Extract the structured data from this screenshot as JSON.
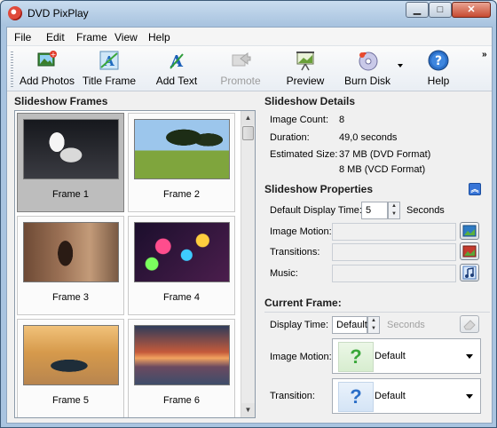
{
  "window": {
    "title": "DVD PixPlay",
    "minimize": "▁",
    "maximize": "□",
    "close": "✕"
  },
  "menu": [
    "File",
    "Edit",
    "Frame",
    "View",
    "Help"
  ],
  "toolbar": {
    "items": [
      {
        "label": "Add Photos",
        "icon": "add-photos-icon",
        "enabled": true
      },
      {
        "label": "Title Frame",
        "icon": "title-frame-icon",
        "enabled": true
      },
      {
        "label": "Add Text",
        "icon": "add-text-icon",
        "enabled": true
      },
      {
        "label": "Promote",
        "icon": "promote-icon",
        "enabled": false
      },
      {
        "label": "Preview",
        "icon": "preview-icon",
        "enabled": true
      },
      {
        "label": "Burn Disk",
        "icon": "burn-disk-icon",
        "enabled": true
      },
      {
        "label": "Help",
        "icon": "help-icon",
        "enabled": true
      }
    ],
    "overflow": "»"
  },
  "frames_panel": {
    "title": "Slideshow Frames",
    "frames": [
      {
        "label": "Frame 1",
        "selected": true
      },
      {
        "label": "Frame 2",
        "selected": false
      },
      {
        "label": "Frame 3",
        "selected": false
      },
      {
        "label": "Frame 4",
        "selected": false
      },
      {
        "label": "Frame 5",
        "selected": false
      },
      {
        "label": "Frame 6",
        "selected": false
      }
    ]
  },
  "details": {
    "title": "Slideshow Details",
    "image_count_label": "Image Count:",
    "image_count": "8",
    "duration_label": "Duration:",
    "duration": "49,0 seconds",
    "size_label": "Estimated Size:",
    "size_dvd": "37 MB (DVD Format)",
    "size_vcd": "8 MB (VCD Format)"
  },
  "properties": {
    "title": "Slideshow Properties",
    "display_time_label": "Default Display Time:",
    "display_time": "5",
    "display_time_unit": "Seconds",
    "image_motion_label": "Image Motion:",
    "image_motion": "",
    "transitions_label": "Transitions:",
    "transitions": "",
    "music_label": "Music:",
    "music": ""
  },
  "current_frame": {
    "title": "Current Frame:",
    "display_time_label": "Display Time:",
    "display_time": "Default",
    "display_time_unit": "Seconds",
    "image_motion_label": "Image Motion:",
    "image_motion": "Default",
    "transition_label": "Transition:",
    "transition": "Default"
  }
}
